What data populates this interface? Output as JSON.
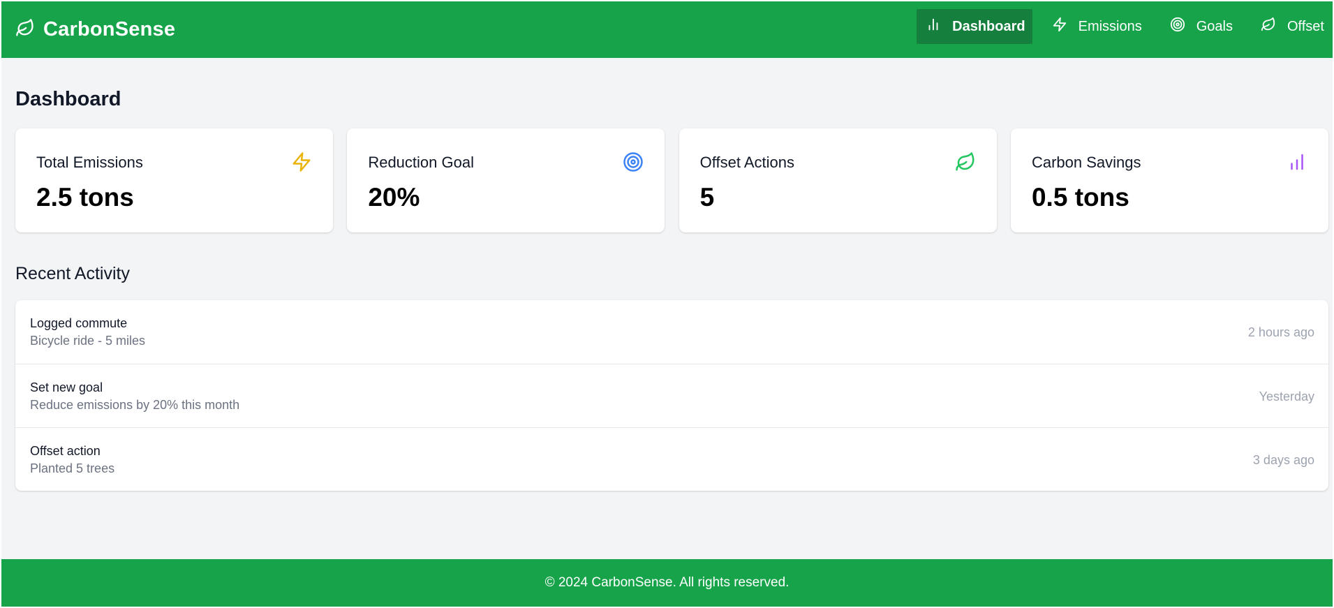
{
  "colors": {
    "brand_green": "#16a34a",
    "nav_active": "#15803d",
    "background": "#f3f4f6",
    "card": "#ffffff",
    "emissions_icon": "#eab308",
    "goal_icon": "#3b82f6",
    "offset_icon": "#22c55e",
    "savings_icon": "#a855f7"
  },
  "header": {
    "logo_icon": "leaf-icon",
    "brand_name": "CarbonSense",
    "nav": [
      {
        "label": "Dashboard",
        "icon": "bar-chart-icon",
        "active": true
      },
      {
        "label": "Emissions",
        "icon": "zap-icon",
        "active": false
      },
      {
        "label": "Goals",
        "icon": "target-icon",
        "active": false
      },
      {
        "label": "Offset",
        "icon": "leaf-icon",
        "active": false
      }
    ]
  },
  "main": {
    "title": "Dashboard",
    "stats": [
      {
        "label": "Total Emissions",
        "value": "2.5 tons",
        "icon": "zap-icon"
      },
      {
        "label": "Reduction Goal",
        "value": "20%",
        "icon": "target-icon"
      },
      {
        "label": "Offset Actions",
        "value": "5",
        "icon": "leaf-icon"
      },
      {
        "label": "Carbon Savings",
        "value": "0.5 tons",
        "icon": "bar-chart-icon"
      }
    ],
    "recent_activity": {
      "title": "Recent Activity",
      "items": [
        {
          "title": "Logged commute",
          "description": "Bicycle ride - 5 miles",
          "time": "2 hours ago"
        },
        {
          "title": "Set new goal",
          "description": "Reduce emissions by 20% this month",
          "time": "Yesterday"
        },
        {
          "title": "Offset action",
          "description": "Planted 5 trees",
          "time": "3 days ago"
        }
      ]
    }
  },
  "footer": {
    "text": "© 2024 CarbonSense. All rights reserved."
  }
}
